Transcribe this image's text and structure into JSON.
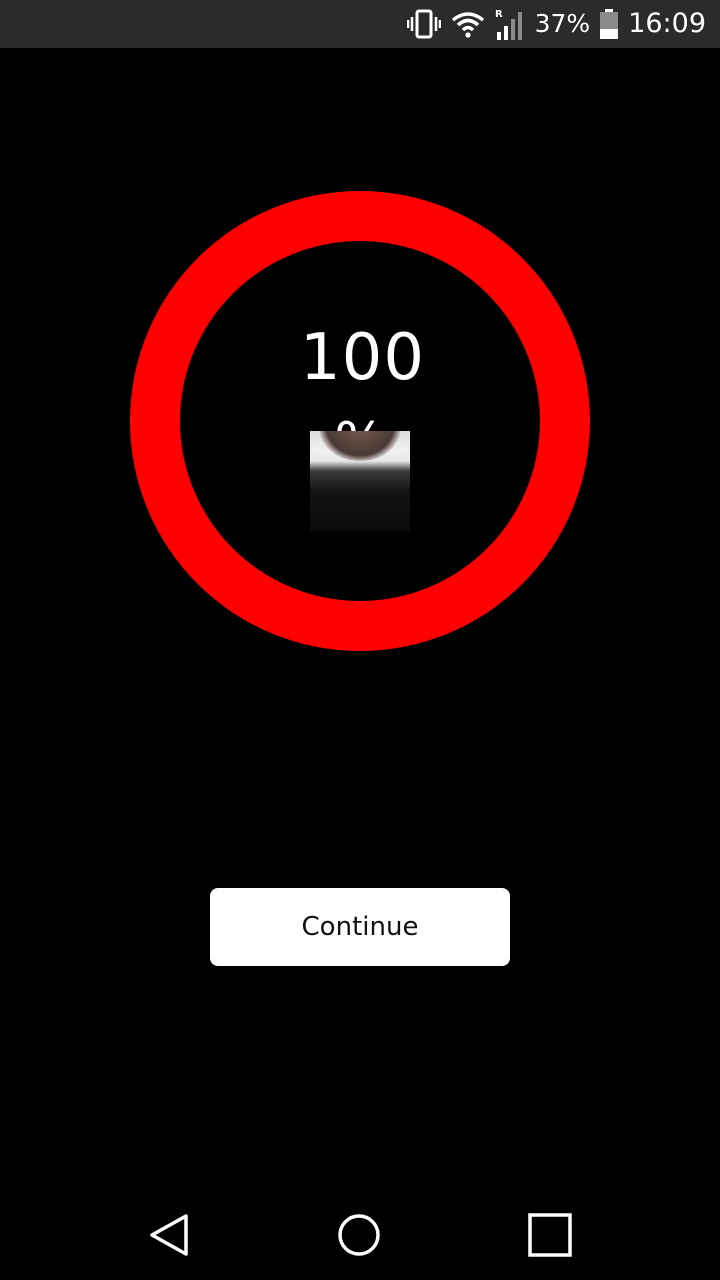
{
  "status_bar": {
    "battery_percent": "37%",
    "time": "16:09",
    "battery_level": 0.37,
    "icons": [
      "vibrate-icon",
      "wifi-icon",
      "roaming-signal-icon",
      "battery-icon"
    ],
    "roaming_indicator": "R"
  },
  "progress": {
    "value": "100",
    "unit": "%",
    "level": 1.0,
    "ring_color": "#ff0000"
  },
  "actions": {
    "continue_label": "Continue"
  },
  "nav_bar": {
    "icons": [
      "back-icon",
      "home-icon",
      "recents-icon"
    ]
  }
}
